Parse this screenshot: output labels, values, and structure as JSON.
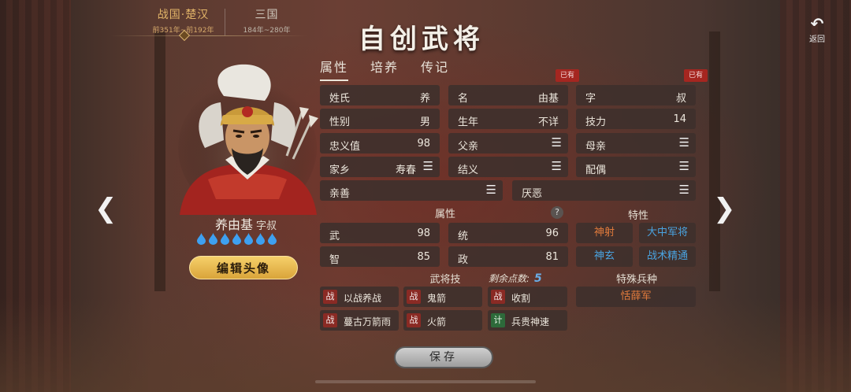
{
  "periods": [
    {
      "name": "战国·楚汉",
      "range": "前351年~前192年",
      "active": true
    },
    {
      "name": "三国",
      "range": "184年~280年",
      "active": false
    }
  ],
  "title": "自创武将",
  "back_label": "返回",
  "tabs": [
    {
      "label": "属性",
      "active": true
    },
    {
      "label": "培养",
      "active": false
    },
    {
      "label": "传记",
      "active": false
    }
  ],
  "owned_badges": [
    "已有",
    "已有"
  ],
  "hero": {
    "name": "养由基",
    "courtesy": "字叔",
    "drops_count": 7,
    "edit_avatar_label": "编辑头像"
  },
  "basic": {
    "surname": {
      "label": "姓氏",
      "value": "养"
    },
    "given_name": {
      "label": "名",
      "value": "由基"
    },
    "courtesy_name": {
      "label": "字",
      "value": "叔"
    },
    "gender": {
      "label": "性别",
      "value": "男"
    },
    "birth_year": {
      "label": "生年",
      "value": "不详"
    },
    "skill_power": {
      "label": "技力",
      "value": "14"
    },
    "loyalty": {
      "label": "忠义值",
      "value": "98"
    },
    "father": {
      "label": "父亲"
    },
    "mother": {
      "label": "母亲"
    },
    "hometown": {
      "label": "家乡",
      "value": "寿春"
    },
    "sworn": {
      "label": "结义"
    },
    "spouse": {
      "label": "配偶"
    },
    "likes": {
      "label": "亲善"
    },
    "dislikes": {
      "label": "厌恶"
    }
  },
  "attributes": {
    "header": "属性",
    "war": {
      "label": "武",
      "value": "98"
    },
    "command": {
      "label": "统",
      "value": "96"
    },
    "intellect": {
      "label": "智",
      "value": "85"
    },
    "politics": {
      "label": "政",
      "value": "81"
    }
  },
  "traits": {
    "header": "特性",
    "items": [
      {
        "label": "神射",
        "color": "#e07a3c"
      },
      {
        "label": "大中军将",
        "color": "#4aa3e0"
      },
      {
        "label": "神玄",
        "color": "#4aa3e0"
      },
      {
        "label": "战术精通",
        "color": "#4aa3e0"
      }
    ]
  },
  "skills": {
    "header": "武将技",
    "remaining_label": "剩余点数:",
    "remaining_points": "5",
    "items": [
      {
        "tag": "战",
        "type": "war",
        "name": "以战养战"
      },
      {
        "tag": "战",
        "type": "war",
        "name": "鬼箭"
      },
      {
        "tag": "战",
        "type": "war",
        "name": "收割"
      },
      {
        "tag": "战",
        "type": "war",
        "name": "蔓古万箭雨"
      },
      {
        "tag": "战",
        "type": "war",
        "name": "火箭"
      },
      {
        "tag": "计",
        "type": "plan",
        "name": "兵贵神速"
      }
    ]
  },
  "special_troop": {
    "header": "特殊兵种",
    "value": "恬薛军",
    "color": "#e07a3c"
  },
  "save_label": "保存",
  "colors": {
    "accent_gold": "#e2b468",
    "badge_red": "#a52620",
    "drop_blue": "#3ea0f0"
  }
}
